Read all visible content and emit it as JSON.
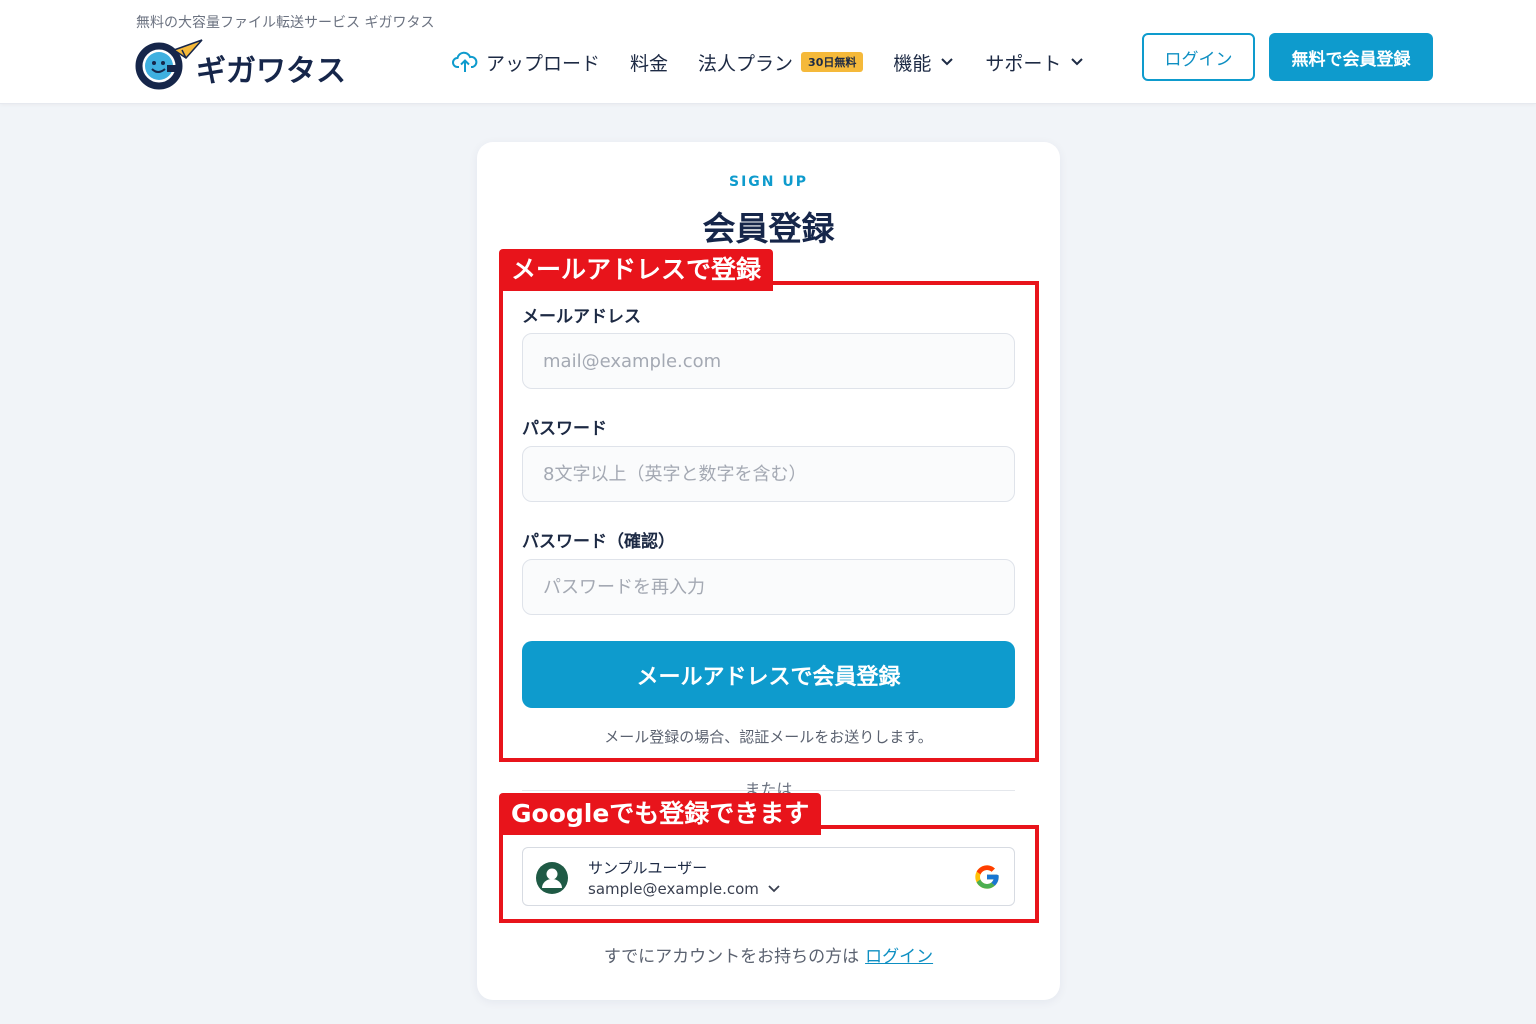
{
  "header": {
    "tagline": "無料の大容量ファイル転送サービス ギガワタス",
    "logo_text": "ギガワタス",
    "nav": [
      {
        "label": "アップロード"
      },
      {
        "label": "料金"
      },
      {
        "label": "法人プラン",
        "badge": "30日無料"
      },
      {
        "label": "機能"
      },
      {
        "label": "サポート"
      }
    ],
    "login_label": "ログイン",
    "signup_label": "無料で会員登録"
  },
  "form": {
    "eyebrow": "SIGN UP",
    "title": "会員登録",
    "email_label": "メールアドレス",
    "email_placeholder": "mail@example.com",
    "password_label": "パスワード",
    "password_placeholder": "8文字以上（英字と数字を含む）",
    "password_confirm_label": "パスワード（確認）",
    "password_confirm_placeholder": "パスワードを再入力",
    "submit_label": "メールアドレスで会員登録",
    "note": "メール登録の場合、認証メールをお送りします。",
    "divider": "または",
    "google_account": {
      "name": "サンプルユーザー",
      "email": "sample@example.com"
    },
    "footer_text": "すでにアカウントをお持ちの方は",
    "footer_link": "ログイン"
  },
  "annotations": {
    "email_section": "メールアドレスで登録",
    "google_section": "Googleでも登録できます"
  },
  "colors": {
    "brand": "#0e9bcd",
    "navy": "#16264a",
    "annotation": "#e8141b",
    "badge": "#f5b93a"
  }
}
